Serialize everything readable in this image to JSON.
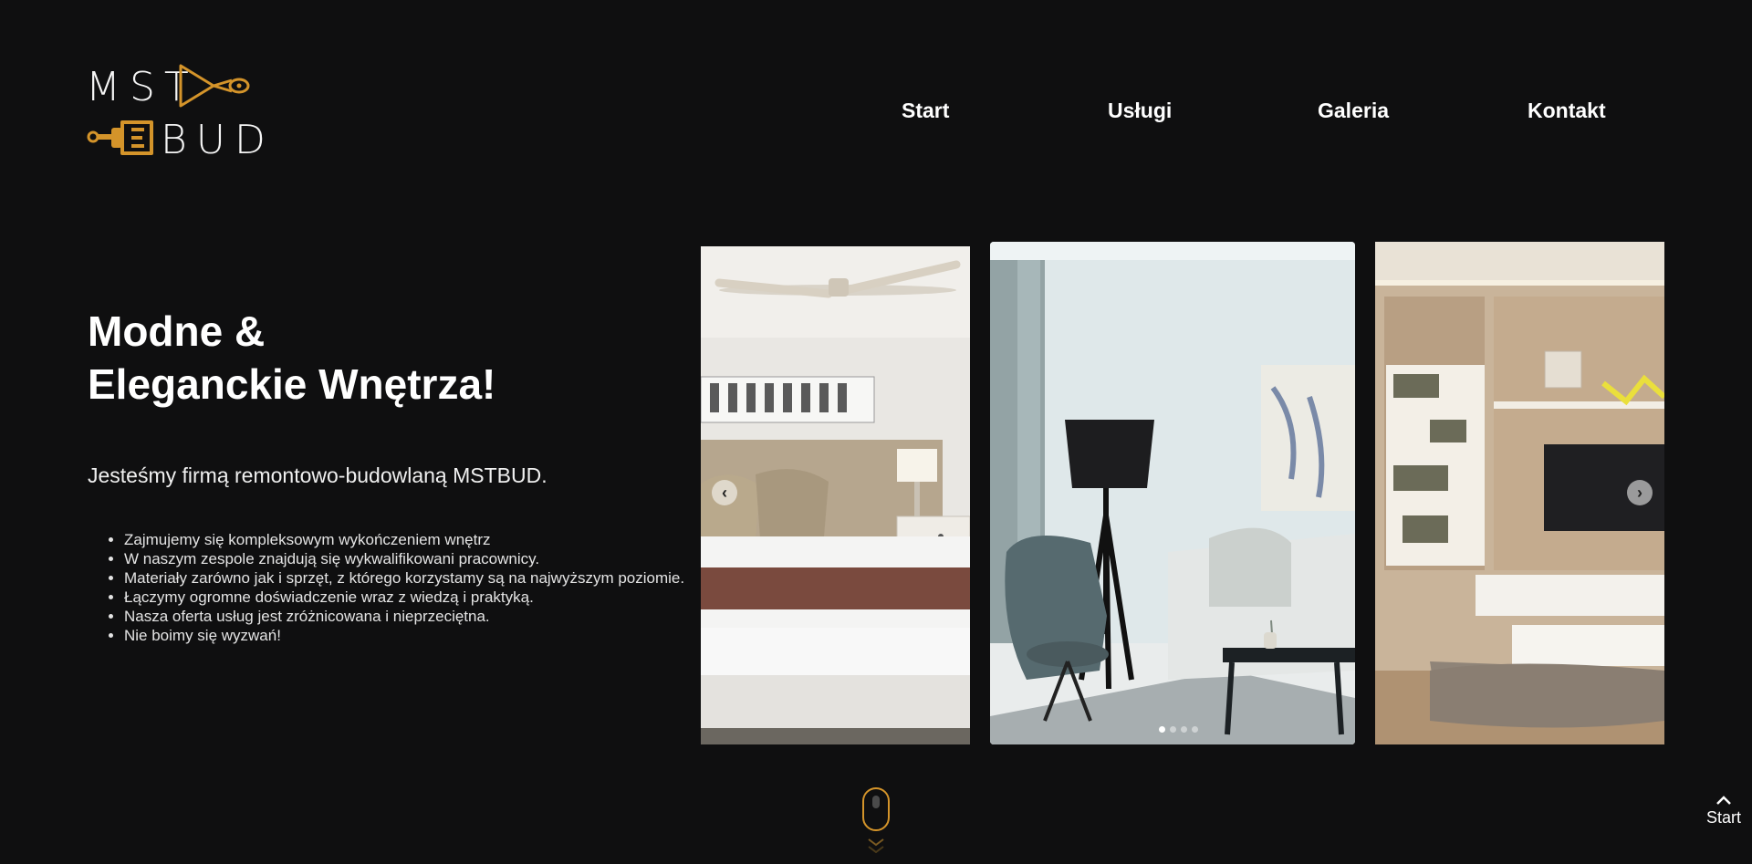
{
  "logo": {
    "line1": "MST",
    "line2": "BUD",
    "accent_color": "#d4942a",
    "icons": [
      "paint-roller-icon",
      "paint-brush-icon"
    ]
  },
  "nav": {
    "items": [
      {
        "label": "Start"
      },
      {
        "label": "Usługi"
      },
      {
        "label": "Galeria"
      },
      {
        "label": "Kontakt"
      }
    ]
  },
  "hero": {
    "title_line1": "Modne &",
    "title_line2": "Eleganckie Wnętrza!",
    "subtitle": "Jesteśmy firmą remontowo-budowlaną MSTBUD.",
    "features": [
      "Zajmujemy się kompleksowym wykończeniem wnętrz",
      "W naszym zespole znajdują się wykwalifikowani pracownicy.",
      "Materiały zarówno jak i sprzęt, z którego korzystamy są na najwyższym poziomie.",
      "Łączymy ogromne doświadczenie wraz z wiedzą i praktyką.",
      "Nasza oferta usług jest zróżnicowana i nieprzeciętna.",
      "Nie boimy się wyzwań!"
    ]
  },
  "carousel": {
    "prev_icon": "chevron-left-icon",
    "next_icon": "chevron-right-icon",
    "slides": [
      "bedroom-photo",
      "living-room-photo",
      "tv-wall-photo"
    ],
    "dots_count": 4,
    "active_dot": 0
  },
  "scroll_indicator": {
    "icon": "mouse-scroll-icon",
    "color": "#d4942a"
  },
  "back_to_top": {
    "label": "Start",
    "icon": "chevron-up-icon"
  }
}
